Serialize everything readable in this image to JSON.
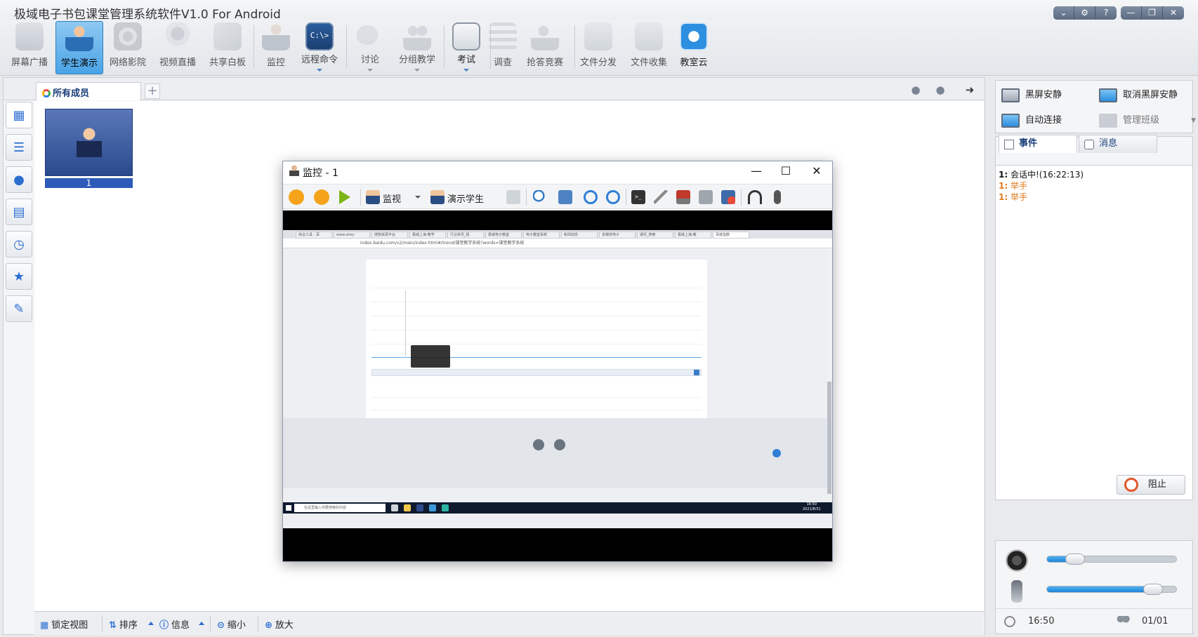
{
  "app": {
    "title": "极域电子书包课堂管理系统软件V1.0 For Android"
  },
  "window_controls": [
    "⌄",
    "⚙",
    "?",
    "—",
    "❐",
    "✕"
  ],
  "toolbar": {
    "items": [
      {
        "label": "屏幕广播",
        "icon": "screen-broadcast-icon"
      },
      {
        "label": "学生演示",
        "icon": "student-demo-icon"
      },
      {
        "label": "网络影院",
        "icon": "film-reel-icon"
      },
      {
        "label": "视频直播",
        "icon": "webcam-icon"
      },
      {
        "label": "共享白板",
        "icon": "whiteboard-icon"
      },
      {
        "label": "监控",
        "icon": "monitor-person-icon"
      },
      {
        "label": "远程命令",
        "icon": "cmd-icon",
        "glyph": "C:\\>"
      },
      {
        "label": "讨论",
        "icon": "chat-icon"
      },
      {
        "label": "分组教学",
        "icon": "group-icon"
      },
      {
        "label": "考试",
        "icon": "exam-clock-icon"
      },
      {
        "label": "调查",
        "icon": "survey-icon"
      },
      {
        "label": "抢答竞赛",
        "icon": "star-person-icon"
      },
      {
        "label": "文件分发",
        "icon": "file-send-icon"
      },
      {
        "label": "文件收集",
        "icon": "file-collect-icon"
      },
      {
        "label": "教室云",
        "icon": "cloud-icon"
      }
    ]
  },
  "workspace": {
    "tab_label": "所有成员",
    "tab_add": "+",
    "student": {
      "label": "1"
    },
    "sidebar": [
      "thumbnail-view-icon",
      "list-view-icon",
      "remove-student-icon",
      "document-icon",
      "schedule-icon",
      "award-student-icon",
      "edit-icon"
    ],
    "bottom_bar": {
      "lock_view": "锁定视图",
      "sort": "排序",
      "info": "信息",
      "zoom_out": "缩小",
      "zoom_in": "放大"
    }
  },
  "monitor_window": {
    "title": "监控 - 1",
    "monitor_label": "监视",
    "demo_label": "演示学生",
    "cmd_glyph": ">_",
    "remote_screen": {
      "address": "index.baidu.com/v2/main/index.html#/trend/课堂教学系统?words=课堂教学系统",
      "tabs": [
        "综合工具 - 百",
        "www.ahey",
        "搜狗资源平台",
        "极域上海-教学",
        "行业资讯_极",
        "极域电子教室",
        "电子教室系统",
        "新闻动态",
        "多媒体电子",
        "通讯_搜索",
        "极域上海-教",
        "百度指数"
      ],
      "taskbar_search": "在这里输入你要搜索的内容",
      "clock_time": "16:50",
      "clock_date": "2021/8/31"
    }
  },
  "right_panel": {
    "black_screen": "黑屏安静",
    "cancel_black_screen": "取消黑屏安静",
    "auto_connect": "自动连接",
    "manage_class": "管理班级",
    "tab_events": "事件",
    "tab_messages": "消息",
    "events": [
      {
        "num": "1:",
        "text": "会话中!(16:22:13)",
        "kind": "ev"
      },
      {
        "num": "1:",
        "text": "举手",
        "kind": "hand"
      },
      {
        "num": "1:",
        "text": "举手",
        "kind": "hand"
      }
    ],
    "block_label": "阻止",
    "speaker_level": 0.22,
    "mic_level": 0.82,
    "time": "16:50",
    "count": "01/01"
  },
  "colors": {
    "accent": "#2d6fd0",
    "active_tile": "#4aa3e6",
    "hand_raise": "#e07a1f",
    "slider_fill": "#1f84d6"
  }
}
